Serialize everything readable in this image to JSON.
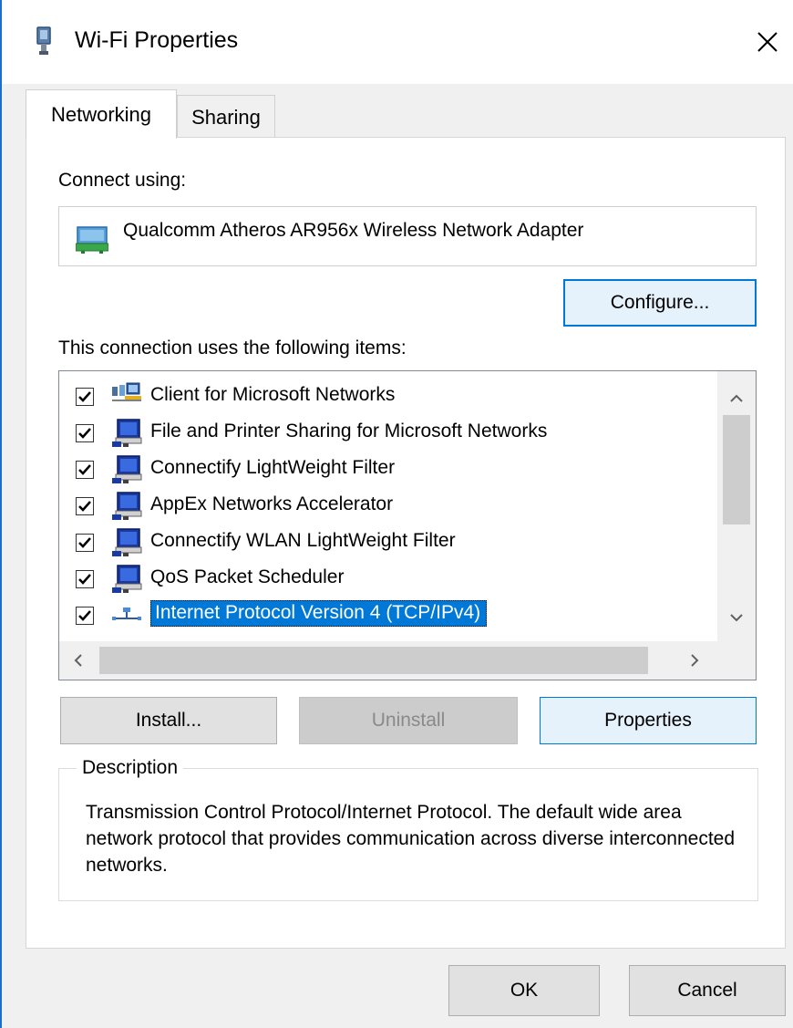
{
  "window": {
    "title": "Wi-Fi Properties",
    "icon": "network-adapter-icon",
    "accent": "#0078d7"
  },
  "tabs": [
    {
      "label": "Networking",
      "selected": true
    },
    {
      "label": "Sharing",
      "selected": false
    }
  ],
  "connect_using": {
    "label": "Connect using:",
    "adapter": "Qualcomm Atheros AR956x Wireless Network Adapter",
    "configure_button": "Configure..."
  },
  "items": {
    "label": "This connection uses the following items:",
    "list": [
      {
        "label": "Client for Microsoft Networks",
        "checked": true,
        "icon": "client-network-icon"
      },
      {
        "label": "File and Printer Sharing for Microsoft Networks",
        "checked": true,
        "icon": "network-service-icon"
      },
      {
        "label": "Connectify LightWeight Filter",
        "checked": true,
        "icon": "network-service-icon"
      },
      {
        "label": "AppEx Networks Accelerator",
        "checked": true,
        "icon": "network-service-icon"
      },
      {
        "label": "Connectify WLAN LightWeight Filter",
        "checked": true,
        "icon": "network-service-icon"
      },
      {
        "label": "QoS Packet Scheduler",
        "checked": true,
        "icon": "network-service-icon"
      },
      {
        "label": "Internet Protocol Version 4 (TCP/IPv4)",
        "checked": true,
        "icon": "protocol-icon",
        "selected": true
      }
    ]
  },
  "buttons": {
    "install": "Install...",
    "uninstall": "Uninstall",
    "properties": "Properties",
    "ok": "OK",
    "cancel": "Cancel"
  },
  "description": {
    "legend": "Description",
    "text": "Transmission Control Protocol/Internet Protocol. The default wide area network protocol that provides communication across diverse interconnected networks."
  }
}
